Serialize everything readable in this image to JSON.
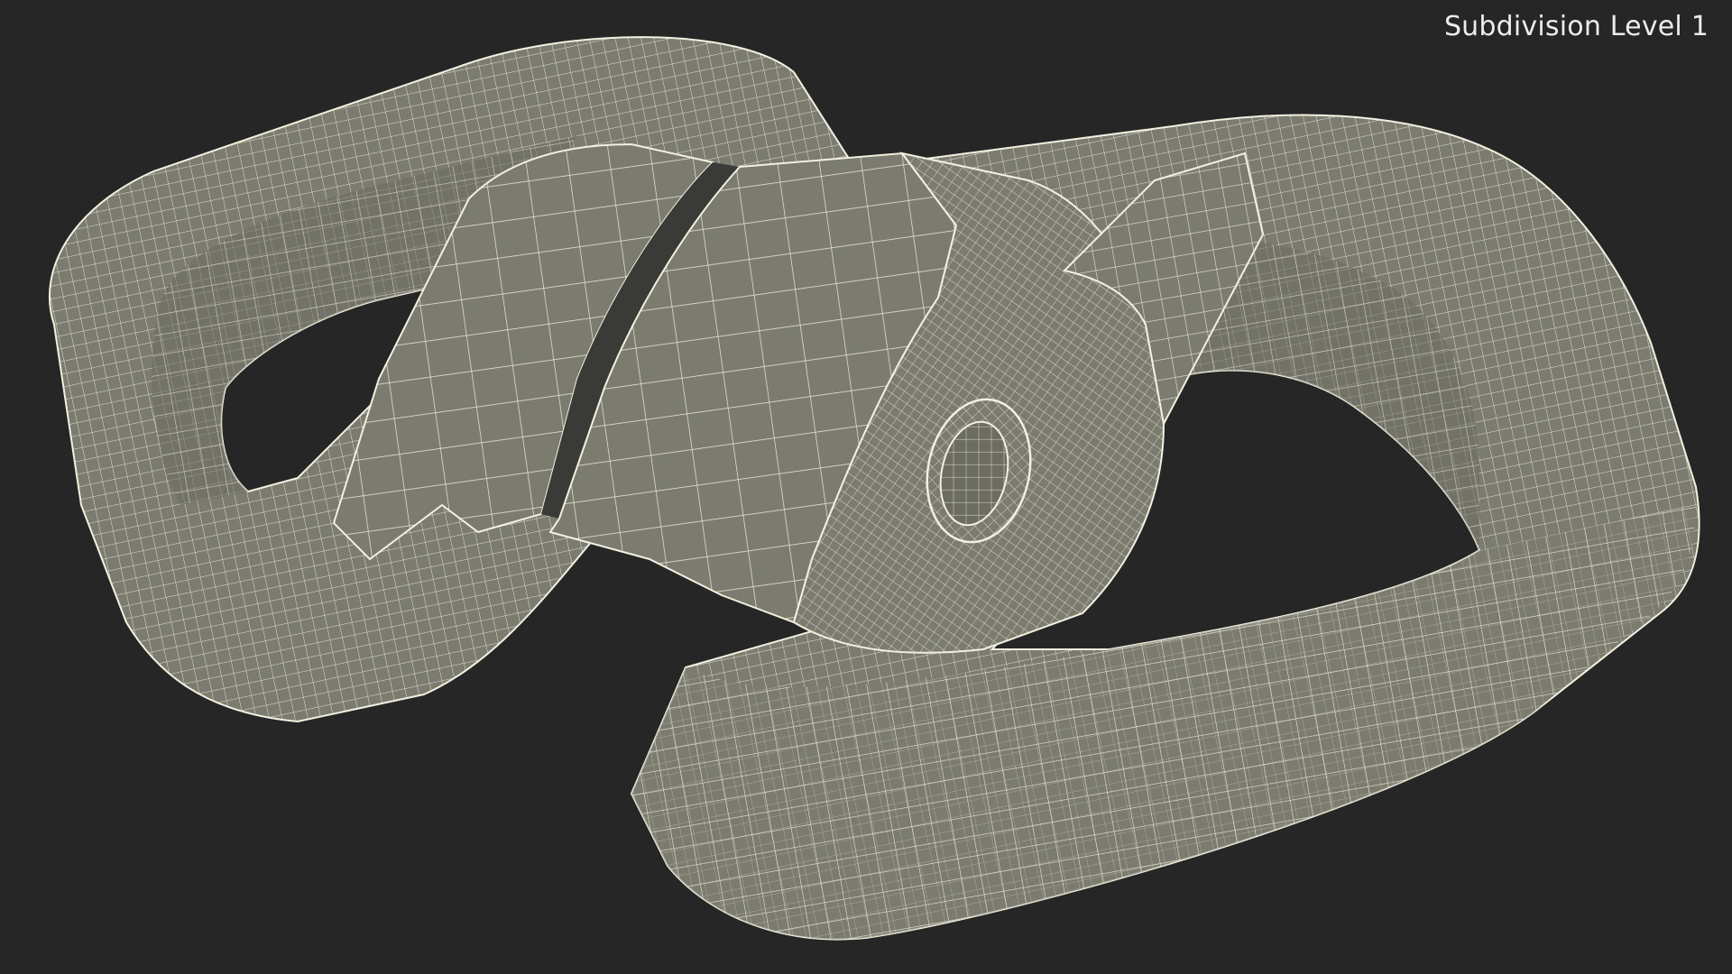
{
  "viewport": {
    "background": "#262626",
    "label": "Subdivision Level 1"
  },
  "model": {
    "icon": "swivel-chain-link-wireframe",
    "surface_color": "#7b7b70",
    "shade_color": "#6c6c62",
    "wire_color": "#f2f0df"
  }
}
